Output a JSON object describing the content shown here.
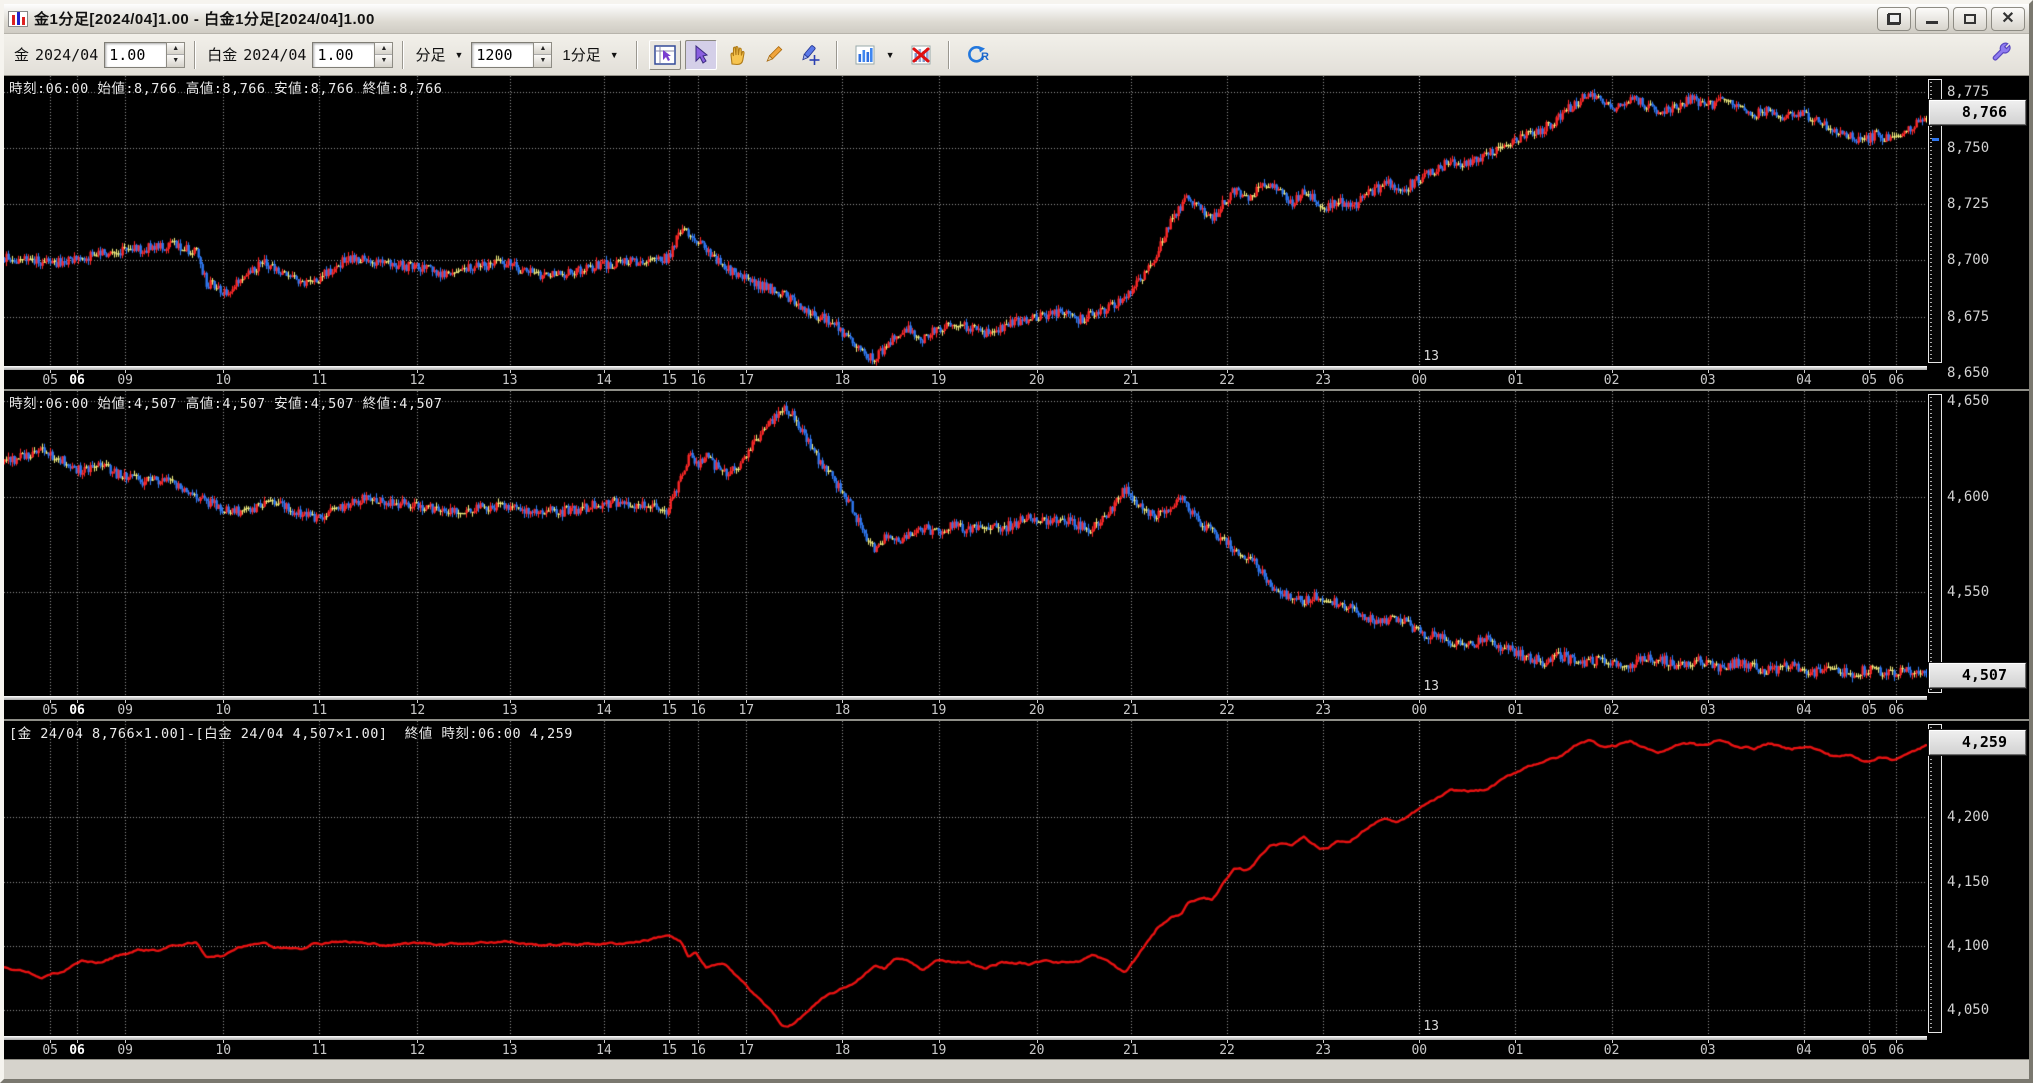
{
  "window": {
    "title": "金1分足[2024/04]1.00 - 白金1分足[2024/04]1.00",
    "buttons": [
      "cascade",
      "minimize",
      "maximize",
      "close"
    ]
  },
  "toolbar": {
    "gold": {
      "label": "金",
      "month": "2024/04",
      "value": "1.00"
    },
    "platinum": {
      "label": "白金",
      "month": "2024/04",
      "value": "1.00"
    },
    "bar": {
      "type_label": "分足",
      "count": "1200",
      "interval_label": "1分足"
    },
    "tools": [
      "chart-pointer",
      "select-cursor",
      "hand-pan",
      "pencil-draw",
      "marker-crosshair",
      "chart-style",
      "chart-delete",
      "reset"
    ],
    "selected_tool": "select-cursor",
    "wrench": "settings"
  },
  "colors": {
    "up_candle": "#ff2828",
    "down_candle": "#2f78f2",
    "doji_candle": "#f2ee7e",
    "spread_line": "#e81212",
    "grid": "#c4c4c4",
    "chart_bg": "#000000",
    "price_box_bg": "#dcdcdc"
  },
  "x_axis": {
    "ticks": [
      {
        "label": "05",
        "f": 0.024
      },
      {
        "label": "06",
        "f": 0.038,
        "strong": true
      },
      {
        "label": "09",
        "f": 0.063
      },
      {
        "label": "10",
        "f": 0.114
      },
      {
        "label": "11",
        "f": 0.164
      },
      {
        "label": "12",
        "f": 0.215
      },
      {
        "label": "13",
        "f": 0.263
      },
      {
        "label": "14",
        "f": 0.312
      },
      {
        "label": "15",
        "f": 0.346
      },
      {
        "label": "16",
        "f": 0.361
      },
      {
        "label": "17",
        "f": 0.386
      },
      {
        "label": "18",
        "f": 0.436
      },
      {
        "label": "19",
        "f": 0.486
      },
      {
        "label": "20",
        "f": 0.537
      },
      {
        "label": "21",
        "f": 0.586
      },
      {
        "label": "22",
        "f": 0.636
      },
      {
        "label": "23",
        "f": 0.686
      },
      {
        "label": "00",
        "f": 0.736,
        "date": true
      },
      {
        "label": "01",
        "f": 0.786
      },
      {
        "label": "02",
        "f": 0.836
      },
      {
        "label": "03",
        "f": 0.886
      },
      {
        "label": "04",
        "f": 0.936
      },
      {
        "label": "05",
        "f": 0.97
      },
      {
        "label": "06",
        "f": 0.984
      }
    ],
    "date_label": {
      "label": "13",
      "f": 0.736
    }
  },
  "chart_data": [
    {
      "type": "candlestick",
      "title": "金 1分足 2024/04",
      "info": "時刻:06:00 始値:8,766 高値:8,766 安値:8,766 終値:8,766",
      "ohlc_last": {
        "time": "06:00",
        "open": 8766,
        "high": 8766,
        "low": 8766,
        "close": 8766
      },
      "last_label": "8,766",
      "last_price": 8766,
      "y_range": [
        8653,
        8782
      ],
      "y_ticks": [
        {
          "label": "8,775",
          "v": 8775
        },
        {
          "label": "8,750",
          "v": 8750
        },
        {
          "label": "8,725",
          "v": 8725
        },
        {
          "label": "8,700",
          "v": 8700
        },
        {
          "label": "8,675",
          "v": 8675
        },
        {
          "label": "8,650",
          "v": 8650
        }
      ],
      "markers": [
        {
          "color": "#ffe94a",
          "v": 8766
        },
        {
          "color": "#2f78f2",
          "v": 8756
        }
      ],
      "seed": 7,
      "noise_amp": 2.2,
      "anchors": [
        [
          0,
          8701
        ],
        [
          0.03,
          8699
        ],
        [
          0.05,
          8703
        ],
        [
          0.07,
          8705
        ],
        [
          0.09,
          8707
        ],
        [
          0.1,
          8703
        ],
        [
          0.105,
          8690
        ],
        [
          0.115,
          8686
        ],
        [
          0.125,
          8694
        ],
        [
          0.135,
          8699
        ],
        [
          0.145,
          8693
        ],
        [
          0.155,
          8690
        ],
        [
          0.165,
          8693
        ],
        [
          0.175,
          8699
        ],
        [
          0.185,
          8701
        ],
        [
          0.2,
          8698
        ],
        [
          0.215,
          8697
        ],
        [
          0.23,
          8694
        ],
        [
          0.245,
          8697
        ],
        [
          0.26,
          8699
        ],
        [
          0.275,
          8694
        ],
        [
          0.29,
          8693
        ],
        [
          0.305,
          8697
        ],
        [
          0.32,
          8699
        ],
        [
          0.335,
          8700
        ],
        [
          0.345,
          8701
        ],
        [
          0.352,
          8713
        ],
        [
          0.358,
          8712
        ],
        [
          0.365,
          8704
        ],
        [
          0.372,
          8699
        ],
        [
          0.38,
          8694
        ],
        [
          0.39,
          8690
        ],
        [
          0.4,
          8687
        ],
        [
          0.41,
          8682
        ],
        [
          0.42,
          8676
        ],
        [
          0.43,
          8673
        ],
        [
          0.437,
          8667
        ],
        [
          0.443,
          8662
        ],
        [
          0.449,
          8656
        ],
        [
          0.455,
          8658
        ],
        [
          0.462,
          8665
        ],
        [
          0.47,
          8669
        ],
        [
          0.478,
          8665
        ],
        [
          0.486,
          8670
        ],
        [
          0.494,
          8673
        ],
        [
          0.502,
          8670
        ],
        [
          0.51,
          8667
        ],
        [
          0.52,
          8671
        ],
        [
          0.53,
          8674
        ],
        [
          0.54,
          8675
        ],
        [
          0.55,
          8677
        ],
        [
          0.558,
          8673
        ],
        [
          0.566,
          8676
        ],
        [
          0.574,
          8679
        ],
        [
          0.582,
          8682
        ],
        [
          0.59,
          8690
        ],
        [
          0.598,
          8700
        ],
        [
          0.604,
          8712
        ],
        [
          0.61,
          8722
        ],
        [
          0.616,
          8728
        ],
        [
          0.622,
          8724
        ],
        [
          0.628,
          8718
        ],
        [
          0.634,
          8726
        ],
        [
          0.64,
          8731
        ],
        [
          0.646,
          8727
        ],
        [
          0.652,
          8731
        ],
        [
          0.658,
          8734
        ],
        [
          0.664,
          8730
        ],
        [
          0.67,
          8726
        ],
        [
          0.676,
          8731
        ],
        [
          0.682,
          8727
        ],
        [
          0.688,
          8723
        ],
        [
          0.694,
          8727
        ],
        [
          0.7,
          8723
        ],
        [
          0.706,
          8727
        ],
        [
          0.712,
          8731
        ],
        [
          0.72,
          8734
        ],
        [
          0.728,
          8732
        ],
        [
          0.736,
          8736
        ],
        [
          0.744,
          8740
        ],
        [
          0.752,
          8744
        ],
        [
          0.76,
          8742
        ],
        [
          0.768,
          8746
        ],
        [
          0.776,
          8749
        ],
        [
          0.784,
          8752
        ],
        [
          0.792,
          8756
        ],
        [
          0.8,
          8758
        ],
        [
          0.808,
          8763
        ],
        [
          0.816,
          8769
        ],
        [
          0.824,
          8774
        ],
        [
          0.83,
          8771
        ],
        [
          0.838,
          8768
        ],
        [
          0.846,
          8772
        ],
        [
          0.854,
          8769
        ],
        [
          0.862,
          8766
        ],
        [
          0.87,
          8769
        ],
        [
          0.878,
          8772
        ],
        [
          0.886,
          8769
        ],
        [
          0.894,
          8771
        ],
        [
          0.902,
          8768
        ],
        [
          0.91,
          8765
        ],
        [
          0.918,
          8767
        ],
        [
          0.926,
          8764
        ],
        [
          0.934,
          8766
        ],
        [
          0.942,
          8762
        ],
        [
          0.95,
          8759
        ],
        [
          0.958,
          8756
        ],
        [
          0.966,
          8753
        ],
        [
          0.974,
          8756
        ],
        [
          0.982,
          8753
        ],
        [
          0.99,
          8758
        ],
        [
          1,
          8763
        ]
      ]
    },
    {
      "type": "candlestick",
      "title": "白金 1分足 2024/04",
      "info": "時刻:06:00 始値:4,507 高値:4,507 安値:4,507 終値:4,507",
      "ohlc_last": {
        "time": "06:00",
        "open": 4507,
        "high": 4507,
        "low": 4507,
        "close": 4507
      },
      "last_label": "4,507",
      "last_price": 4507,
      "y_range": [
        4496,
        4655
      ],
      "y_ticks": [
        {
          "label": "4,650",
          "v": 4650
        },
        {
          "label": "4,600",
          "v": 4600
        },
        {
          "label": "4,550",
          "v": 4550
        }
      ],
      "markers": [
        {
          "color": "#ffe94a",
          "v": 4512
        },
        {
          "color": "#ffe94a",
          "v": 4503
        }
      ],
      "seed": 13,
      "noise_amp": 2.7,
      "anchors": [
        [
          0,
          4618
        ],
        [
          0.01,
          4621
        ],
        [
          0.02,
          4623
        ],
        [
          0.03,
          4619
        ],
        [
          0.04,
          4613
        ],
        [
          0.05,
          4616
        ],
        [
          0.06,
          4611
        ],
        [
          0.07,
          4608
        ],
        [
          0.08,
          4609
        ],
        [
          0.09,
          4606
        ],
        [
          0.1,
          4601
        ],
        [
          0.11,
          4595
        ],
        [
          0.12,
          4592
        ],
        [
          0.13,
          4594
        ],
        [
          0.14,
          4597
        ],
        [
          0.15,
          4592
        ],
        [
          0.16,
          4589
        ],
        [
          0.17,
          4592
        ],
        [
          0.18,
          4597
        ],
        [
          0.19,
          4599
        ],
        [
          0.2,
          4597
        ],
        [
          0.215,
          4595
        ],
        [
          0.23,
          4592
        ],
        [
          0.245,
          4594
        ],
        [
          0.26,
          4595
        ],
        [
          0.275,
          4593
        ],
        [
          0.29,
          4592
        ],
        [
          0.305,
          4595
        ],
        [
          0.32,
          4597
        ],
        [
          0.335,
          4595
        ],
        [
          0.345,
          4592
        ],
        [
          0.352,
          4610
        ],
        [
          0.356,
          4622
        ],
        [
          0.36,
          4616
        ],
        [
          0.365,
          4621
        ],
        [
          0.37,
          4616
        ],
        [
          0.376,
          4612
        ],
        [
          0.382,
          4617
        ],
        [
          0.388,
          4625
        ],
        [
          0.394,
          4632
        ],
        [
          0.4,
          4640
        ],
        [
          0.405,
          4647
        ],
        [
          0.41,
          4643
        ],
        [
          0.415,
          4634
        ],
        [
          0.42,
          4624
        ],
        [
          0.425,
          4617
        ],
        [
          0.43,
          4611
        ],
        [
          0.436,
          4602
        ],
        [
          0.442,
          4592
        ],
        [
          0.448,
          4578
        ],
        [
          0.453,
          4571
        ],
        [
          0.458,
          4579
        ],
        [
          0.464,
          4576
        ],
        [
          0.47,
          4581
        ],
        [
          0.478,
          4584
        ],
        [
          0.486,
          4581
        ],
        [
          0.494,
          4585
        ],
        [
          0.502,
          4582
        ],
        [
          0.51,
          4585
        ],
        [
          0.518,
          4583
        ],
        [
          0.526,
          4586
        ],
        [
          0.534,
          4589
        ],
        [
          0.542,
          4586
        ],
        [
          0.55,
          4589
        ],
        [
          0.558,
          4585
        ],
        [
          0.566,
          4583
        ],
        [
          0.572,
          4589
        ],
        [
          0.578,
          4597
        ],
        [
          0.583,
          4604
        ],
        [
          0.588,
          4599
        ],
        [
          0.594,
          4593
        ],
        [
          0.6,
          4590
        ],
        [
          0.606,
          4594
        ],
        [
          0.612,
          4599
        ],
        [
          0.618,
          4591
        ],
        [
          0.624,
          4585
        ],
        [
          0.632,
          4579
        ],
        [
          0.64,
          4572
        ],
        [
          0.648,
          4568
        ],
        [
          0.654,
          4561
        ],
        [
          0.66,
          4553
        ],
        [
          0.668,
          4548
        ],
        [
          0.676,
          4545
        ],
        [
          0.684,
          4549
        ],
        [
          0.692,
          4545
        ],
        [
          0.7,
          4542
        ],
        [
          0.708,
          4538
        ],
        [
          0.716,
          4534
        ],
        [
          0.724,
          4537
        ],
        [
          0.732,
          4532
        ],
        [
          0.74,
          4528
        ],
        [
          0.75,
          4525
        ],
        [
          0.76,
          4522
        ],
        [
          0.77,
          4526
        ],
        [
          0.78,
          4521
        ],
        [
          0.79,
          4517
        ],
        [
          0.8,
          4514
        ],
        [
          0.81,
          4517
        ],
        [
          0.82,
          4513
        ],
        [
          0.83,
          4515
        ],
        [
          0.84,
          4511
        ],
        [
          0.85,
          4514
        ],
        [
          0.86,
          4516
        ],
        [
          0.87,
          4512
        ],
        [
          0.88,
          4515
        ],
        [
          0.89,
          4511
        ],
        [
          0.9,
          4513
        ],
        [
          0.91,
          4511
        ],
        [
          0.92,
          4509
        ],
        [
          0.93,
          4512
        ],
        [
          0.94,
          4508
        ],
        [
          0.95,
          4511
        ],
        [
          0.96,
          4507
        ],
        [
          0.97,
          4510
        ],
        [
          0.98,
          4507
        ],
        [
          0.99,
          4509
        ],
        [
          1,
          4507
        ]
      ]
    },
    {
      "type": "line",
      "title": "金-白金 スプレッド",
      "info": "[金 24/04 8,766×1.00]-[白金 24/04 4,507×1.00]  終値 時刻:06:00 4,259",
      "formula": "[金 24/04 8,766×1.00]-[白金 24/04 4,507×1.00]",
      "last_label": "4,259",
      "last_price": 4259,
      "y_range": [
        4030,
        4275
      ],
      "y_ticks": [
        {
          "label": "4,200",
          "v": 4200
        },
        {
          "label": "4,150",
          "v": 4150
        },
        {
          "label": "4,100",
          "v": 4100
        },
        {
          "label": "4,050",
          "v": 4050
        }
      ],
      "markers": [
        {
          "color": "#ff2222",
          "v": 4263
        },
        {
          "color": "#ff2222",
          "v": 4255
        }
      ],
      "seed": 21,
      "noise_amp": 1.3,
      "derive": "difference_of_charts_0_and_1"
    }
  ]
}
